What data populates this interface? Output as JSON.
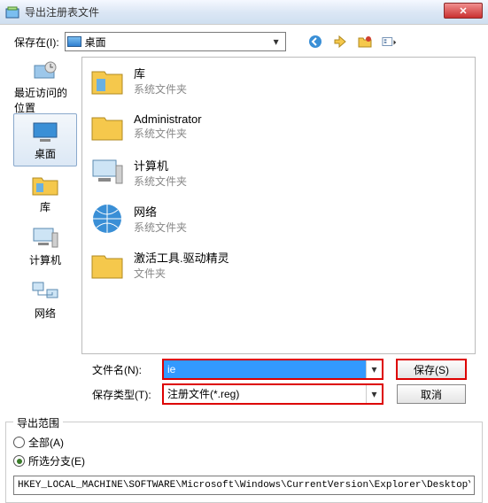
{
  "title": "导出注册表文件",
  "savein": {
    "label": "保存在(I):",
    "value": "桌面"
  },
  "toolbar": {
    "back": "back",
    "up": "up",
    "newfolder": "new-folder",
    "views": "views"
  },
  "places": [
    {
      "label": "最近访问的位置"
    },
    {
      "label": "桌面"
    },
    {
      "label": "库"
    },
    {
      "label": "计算机"
    },
    {
      "label": "网络"
    }
  ],
  "files": [
    {
      "name": "库",
      "type": "系统文件夹",
      "icon": "library"
    },
    {
      "name": "Administrator",
      "type": "系统文件夹",
      "icon": "folder"
    },
    {
      "name": "计算机",
      "type": "系统文件夹",
      "icon": "computer"
    },
    {
      "name": "网络",
      "type": "系统文件夹",
      "icon": "network"
    },
    {
      "name": "激活工具.驱动精灵",
      "type": "文件夹",
      "icon": "folder"
    }
  ],
  "filename": {
    "label": "文件名(N):",
    "value": "ie"
  },
  "filetype": {
    "label": "保存类型(T):",
    "value": "注册文件(*.reg)"
  },
  "buttons": {
    "save": "保存(S)",
    "cancel": "取消"
  },
  "export": {
    "legend": "导出范围",
    "all": "全部(A)",
    "branch": "所选分支(E)",
    "branch_value": "HKEY_LOCAL_MACHINE\\SOFTWARE\\Microsoft\\Windows\\CurrentVersion\\Explorer\\Desktop\\Nam"
  }
}
